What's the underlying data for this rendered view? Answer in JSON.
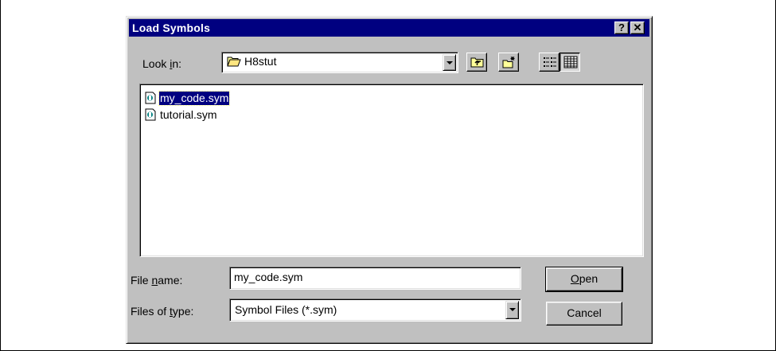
{
  "dialog": {
    "title": "Load Symbols",
    "help_button": "?",
    "close_button": "✕"
  },
  "look_in": {
    "label_pre": "Look ",
    "label_accel": "i",
    "label_post": "n:",
    "value": "H8stut"
  },
  "files": [
    {
      "name": "my_code.sym",
      "selected": true
    },
    {
      "name": "tutorial.sym",
      "selected": false
    }
  ],
  "file_name": {
    "label_pre": "File ",
    "label_accel": "n",
    "label_post": "ame:",
    "value": "my_code.sym"
  },
  "files_of_type": {
    "label_pre": "Files of ",
    "label_accel": "t",
    "label_post": "ype:",
    "value": "Symbol Files (*.sym)"
  },
  "buttons": {
    "open_accel": "O",
    "open_rest": "pen",
    "cancel": "Cancel"
  },
  "toolbar_icons": [
    "up-one-level-icon",
    "create-new-folder-icon",
    "list-view-icon",
    "details-view-icon"
  ],
  "colors": {
    "titlebar": "#000080",
    "dialog_face": "#c0c0c0",
    "selection": "#000080"
  }
}
